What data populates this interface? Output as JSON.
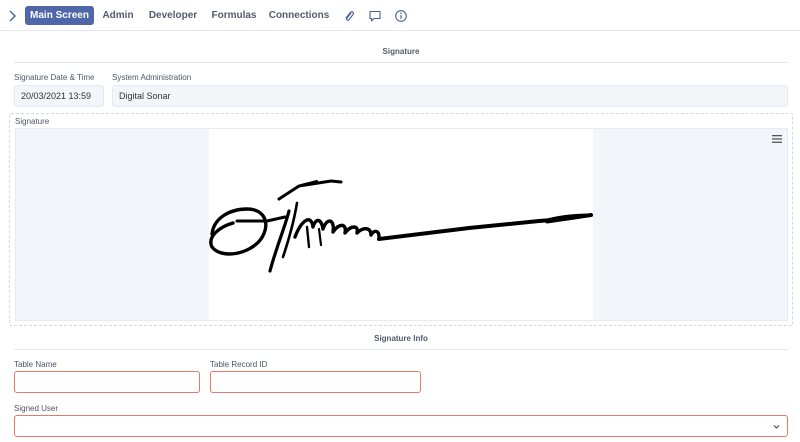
{
  "nav": {
    "tabs": [
      {
        "label": "Main Screen",
        "active": true
      },
      {
        "label": "Admin",
        "active": false
      },
      {
        "label": "Developer",
        "active": false
      },
      {
        "label": "Formulas",
        "active": false
      },
      {
        "label": "Connections",
        "active": false
      }
    ],
    "icons": [
      "chevron-right-icon",
      "paperclip-icon",
      "comment-icon",
      "info-icon"
    ]
  },
  "signature_section": {
    "title": "Signature",
    "date_label": "Signature Date & Time",
    "date_value": "20/03/2021 13:59",
    "admin_label": "System Administration",
    "admin_value": "Digital Sonar",
    "signature_label": "Signature"
  },
  "info_section": {
    "title": "Signature Info",
    "table_name_label": "Table Name",
    "table_name_value": "",
    "record_id_label": "Table Record ID",
    "record_id_value": "",
    "signed_user_label": "Signed User",
    "signed_user_value": ""
  },
  "colors": {
    "accent": "#4f66a8",
    "error_border": "#e57a6a",
    "readonly_bg": "#f3f5fa"
  }
}
